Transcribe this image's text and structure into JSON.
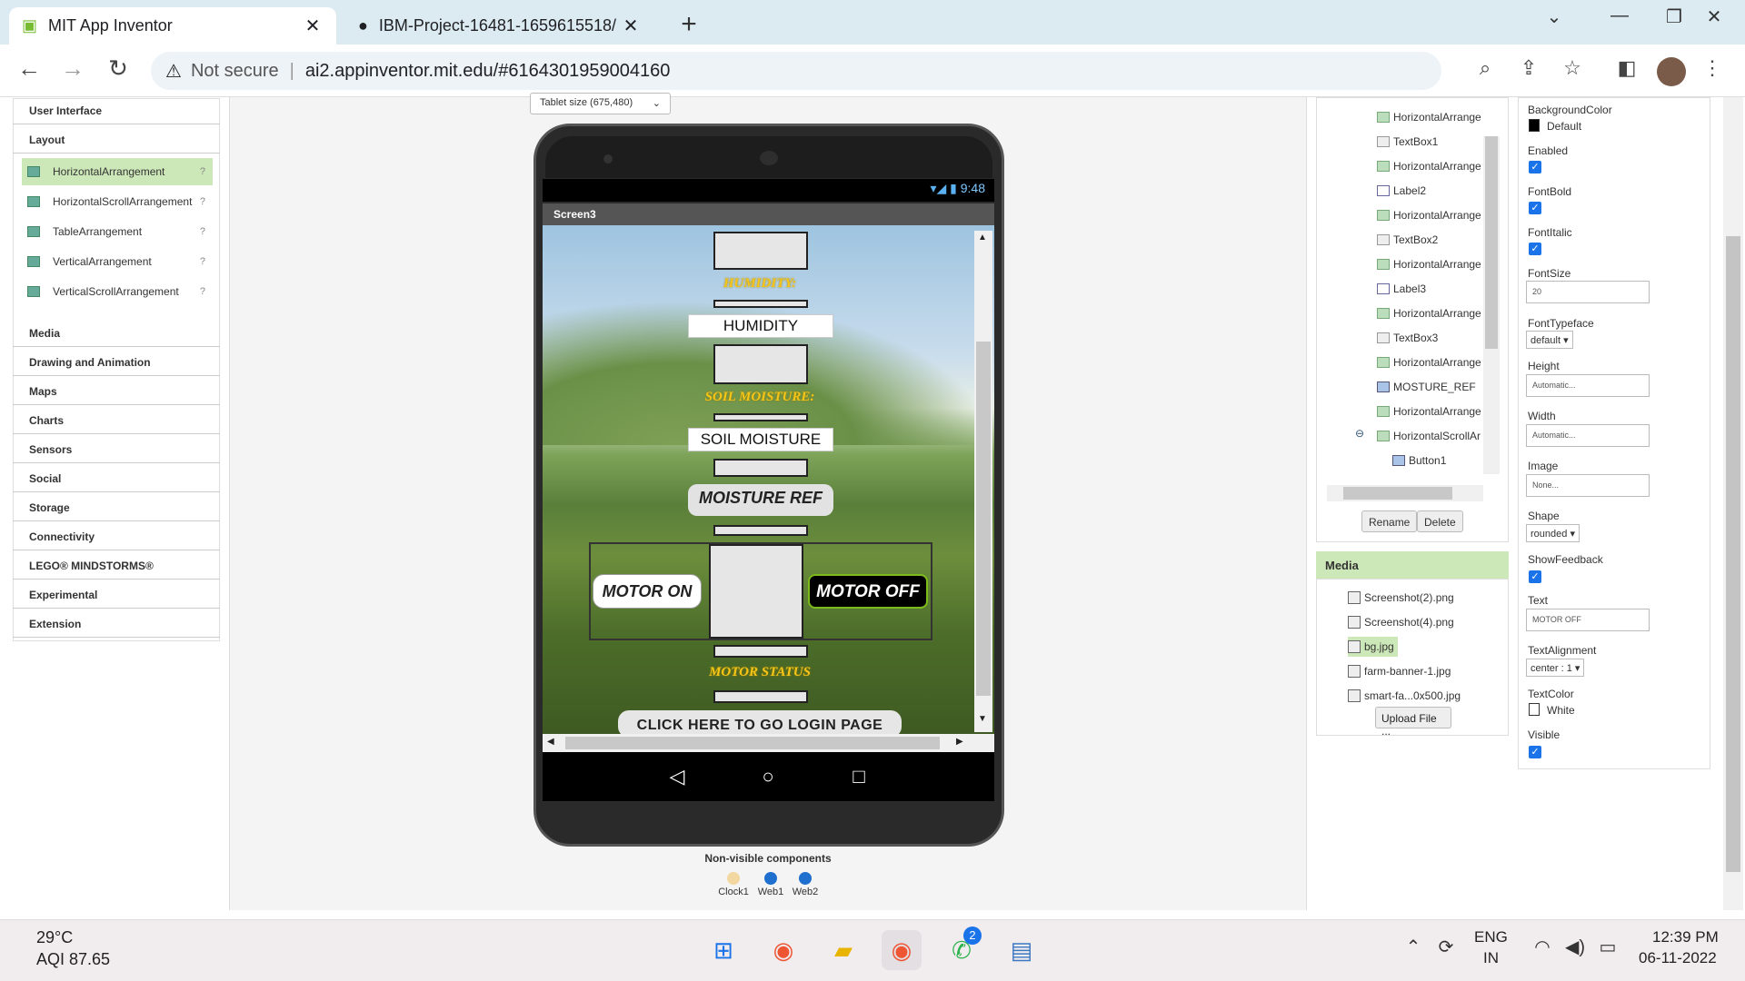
{
  "browser": {
    "tabs": [
      {
        "title": "MIT App Inventor",
        "active": true
      },
      {
        "title": "IBM-Project-16481-1659615518/",
        "active": false
      }
    ],
    "new_tab": "+",
    "security": "Not secure",
    "url": "ai2.appinventor.mit.edu/#6164301959004160"
  },
  "palette": {
    "categories_top": [
      "User Interface",
      "Layout"
    ],
    "layout_items": [
      "HorizontalArrangement",
      "HorizontalScrollArrangement",
      "TableArrangement",
      "VerticalArrangement",
      "VerticalScrollArrangement"
    ],
    "help": "?",
    "categories_bottom": [
      "Media",
      "Drawing and Animation",
      "Maps",
      "Charts",
      "Sensors",
      "Social",
      "Storage",
      "Connectivity",
      "LEGO® MINDSTORMS®",
      "Experimental",
      "Extension"
    ]
  },
  "viewer": {
    "size_dropdown": "Tablet size (675,480)",
    "status_time": "9:48",
    "screen_title": "Screen3",
    "humidity_label": "HUMIDITY:",
    "humidity_box": "HUMIDITY",
    "soil_label": "SOIL MOISTURE:",
    "soil_box": "SOIL MOISTURE",
    "moisture_ref": "MOISTURE REF",
    "motor_on": "MOTOR ON",
    "motor_off": "MOTOR OFF",
    "motor_status": "MOTOR STATUS",
    "login_button": "CLICK HERE TO GO LOGIN PAGE",
    "nonvisible_title": "Non-visible components",
    "nonvisible": [
      "Clock1",
      "Web1",
      "Web2"
    ]
  },
  "tree": {
    "items": [
      "HorizontalArrange",
      "TextBox1",
      "HorizontalArrange",
      "Label2",
      "HorizontalArrange",
      "TextBox2",
      "HorizontalArrange",
      "Label3",
      "HorizontalArrange",
      "TextBox3",
      "HorizontalArrange",
      "MOSTURE_REF",
      "HorizontalArrange",
      "HorizontalScrollAr",
      "Button1"
    ],
    "collapse": "⊖",
    "rename": "Rename",
    "delete": "Delete"
  },
  "media": {
    "title": "Media",
    "files": [
      "Screenshot(2).png",
      "Screenshot(4).png",
      "bg.jpg",
      "farm-banner-1.jpg",
      "smart-fa...0x500.jpg"
    ],
    "upload": "Upload File ..."
  },
  "properties": {
    "bgcolor_label": "BackgroundColor",
    "bgcolor_value": "Default",
    "enabled_label": "Enabled",
    "fontbold_label": "FontBold",
    "fontitalic_label": "FontItalic",
    "fontsize_label": "FontSize",
    "fontsize_value": "20",
    "typeface_label": "FontTypeface",
    "typeface_value": "default",
    "height_label": "Height",
    "height_value": "Automatic...",
    "width_label": "Width",
    "width_value": "Automatic...",
    "image_label": "Image",
    "image_value": "None...",
    "shape_label": "Shape",
    "shape_value": "rounded",
    "feedback_label": "ShowFeedback",
    "text_label": "Text",
    "text_value": "MOTOR OFF",
    "align_label": "TextAlignment",
    "align_value": "center : 1",
    "textcolor_label": "TextColor",
    "textcolor_value": "White",
    "visible_label": "Visible",
    "dd_arrow": "▾",
    "check": "✓"
  },
  "taskbar": {
    "temperature": "29°C",
    "aqi": "AQI 87.65",
    "whatsapp_badge": "2",
    "lang1": "ENG",
    "lang2": "IN",
    "time": "12:39 PM",
    "date": "06-11-2022"
  },
  "colors": {
    "accent": "#1a73e8",
    "selected": "#cde8b8",
    "motor_off_border": "#7cbb1a",
    "label_yellow": "#f5c518"
  }
}
